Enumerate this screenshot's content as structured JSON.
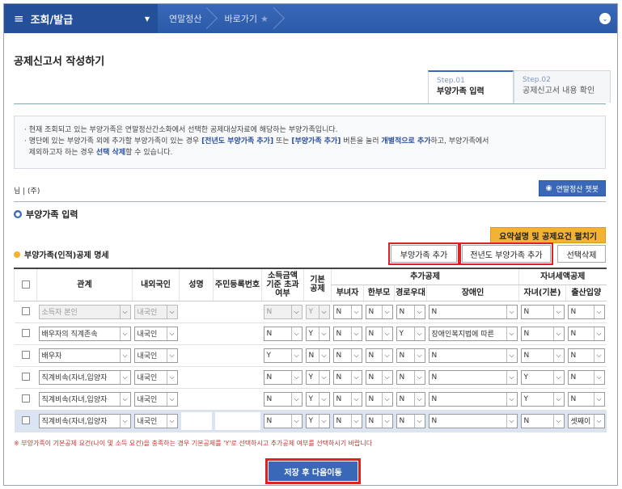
{
  "nav": {
    "menu_title": "조회/발급",
    "crumbs": [
      "연말정산",
      "바로가기"
    ]
  },
  "page": {
    "title": "공제신고서 작성하기"
  },
  "steps": [
    {
      "num": "Step.01",
      "label": "부양가족 입력"
    },
    {
      "num": "Step.02",
      "label": "공제신고서 내용 확인"
    }
  ],
  "notice": {
    "line1": "· 현재 조회되고 있는 부양가족은 연말정산간소화에서 선택한 공제대상자료에 해당하는 부양가족입니다.",
    "line2a": "· 명단에 있는 부양가족 외에 추가할 부양가족이 있는 경우 ",
    "line2b": "[전년도 부양가족 추가]",
    "line2c": " 또는 ",
    "line2d": "[부양가족 추가]",
    "line2e": " 버튼을 눌러 ",
    "line2f": "개별적으로 추가",
    "line2g": "하고, 부양가족에서",
    "line3a": "제외하고자 하는 경우 ",
    "line3b": "선택 삭제",
    "line3c": "할 수 있습니다."
  },
  "info": {
    "text": "님 | (주)",
    "guide_button": "연말정산 챗봇"
  },
  "section": {
    "title": "부양가족 입력",
    "summary_button": "요약설명 및 공제요건 펼치기"
  },
  "subsection": {
    "title": "부양가족(인적)공제 명세"
  },
  "buttons": {
    "add": "부양가족 추가",
    "add_prev": "전년도 부양가족 추가",
    "delete": "선택삭제"
  },
  "table": {
    "headers": {
      "relation": "관계",
      "nationality": "내외국인",
      "name": "성명",
      "rrn": "주민등록번호",
      "income": "소득금액 기준 초과여부",
      "basic": "기본 공제",
      "additional": "추가공제",
      "woman": "부녀자",
      "single_parent": "한부모",
      "elderly": "경로우대",
      "disabled": "장애인",
      "child_credit": "자녀세액공제",
      "child": "자녀(기본)",
      "birth": "출산입양"
    },
    "rows": [
      {
        "relation": "소득자 본인",
        "nationality": "내국인",
        "income": "N",
        "basic": "Y",
        "woman": "N",
        "single_parent": "N",
        "elderly": "N",
        "disabled": "N",
        "child": "N",
        "birth": "N",
        "disabled_row": true
      },
      {
        "relation": "배우자의 직계존속",
        "nationality": "내국인",
        "income": "N",
        "basic": "Y",
        "woman": "N",
        "single_parent": "N",
        "elderly": "Y",
        "disabled": "장애인복지법에 따른",
        "child": "N",
        "birth": "N"
      },
      {
        "relation": "배우자",
        "nationality": "내국인",
        "income": "Y",
        "basic": "N",
        "woman": "N",
        "single_parent": "N",
        "elderly": "N",
        "disabled": "N",
        "child": "N",
        "birth": "N"
      },
      {
        "relation": "직계비속(자녀,입양자",
        "nationality": "내국인",
        "income": "N",
        "basic": "Y",
        "woman": "N",
        "single_parent": "N",
        "elderly": "N",
        "disabled": "N",
        "child": "Y",
        "birth": "N"
      },
      {
        "relation": "직계비속(자녀,입양자",
        "nationality": "내국인",
        "income": "N",
        "basic": "Y",
        "woman": "N",
        "single_parent": "N",
        "elderly": "N",
        "disabled": "N",
        "child": "Y",
        "birth": "N"
      },
      {
        "relation": "직계비속(자녀,입양자",
        "nationality": "내국인",
        "income": "N",
        "basic": "Y",
        "woman": "N",
        "single_parent": "N",
        "elderly": "N",
        "disabled": "N",
        "child": "N",
        "birth": "셋째이",
        "selected": true
      }
    ]
  },
  "footnote": "※ 부양가족이 기본공제 요건(나이 및 소득 요건)을 충족하는 경우 기본공제를 'Y'로 선택하시고 추가공제 여부를 선택하시기 바랍니다",
  "save_button": "저장 후 다음이동"
}
